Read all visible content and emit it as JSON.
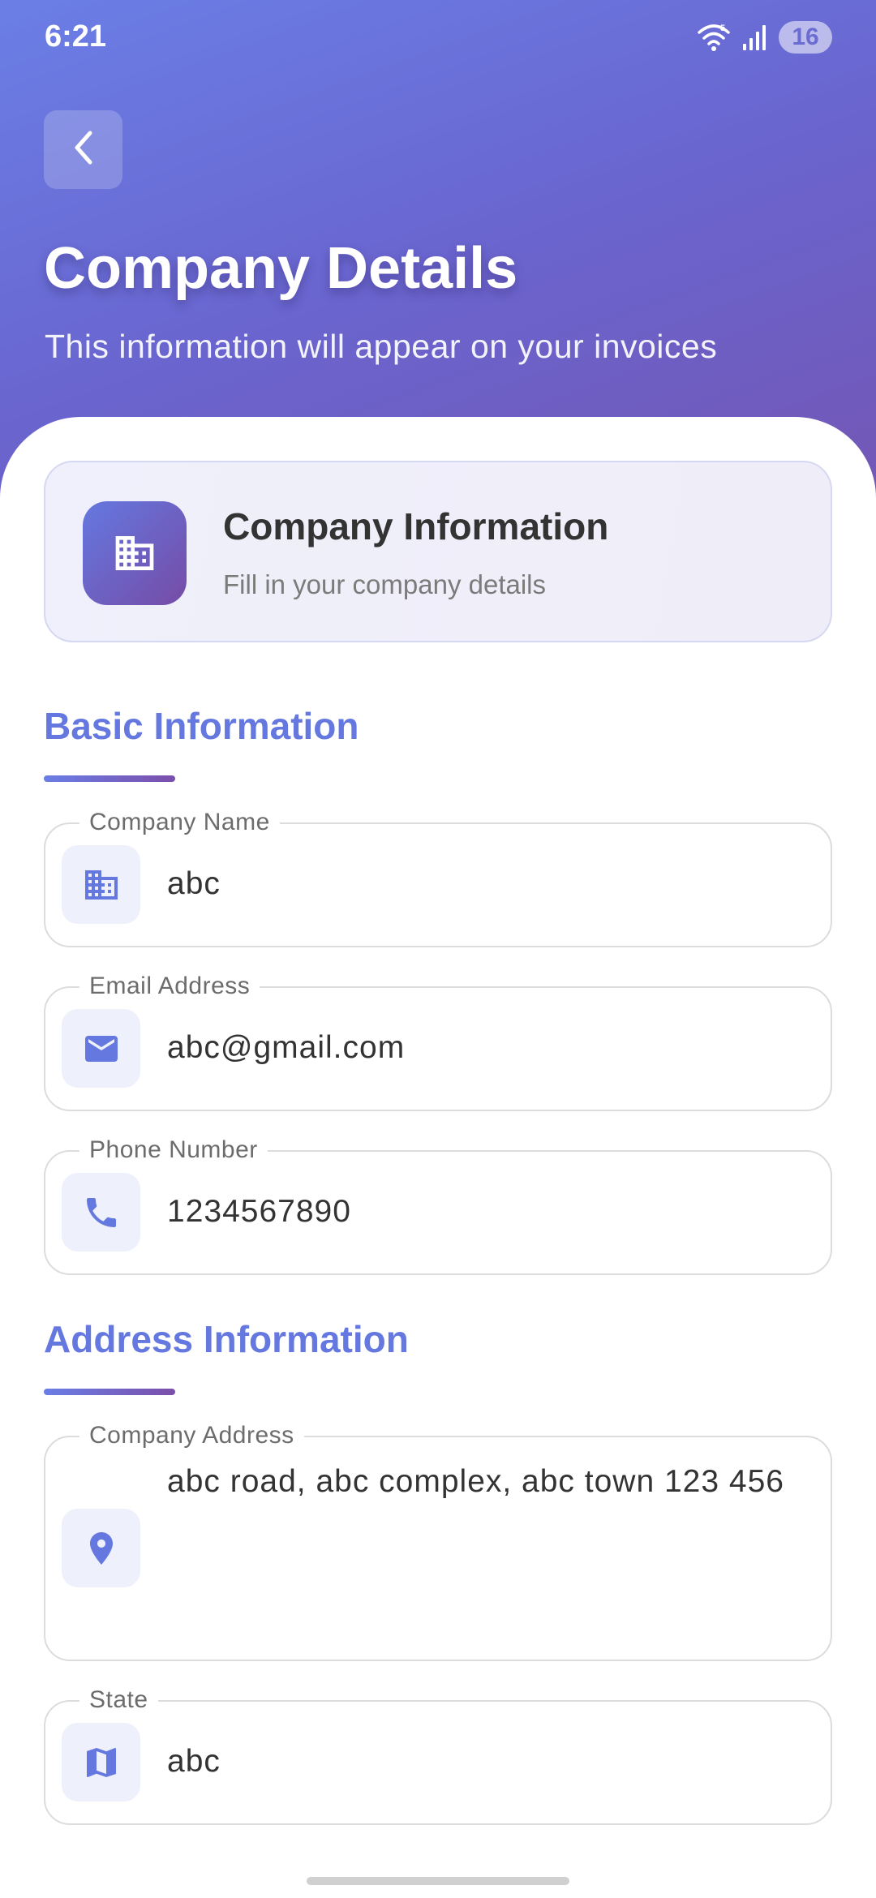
{
  "status_bar": {
    "time": "6:21",
    "battery": "16",
    "wifi_icon": "wifi-icon",
    "signal_icon": "signal-icon"
  },
  "header": {
    "back_icon": "chevron-left-icon",
    "title": "Company Details",
    "subtitle": "This information will appear on your invoices"
  },
  "info_card": {
    "icon": "building-icon",
    "title": "Company Information",
    "subtitle": "Fill in your company details"
  },
  "sections": {
    "basic": {
      "title": "Basic Information"
    },
    "address": {
      "title": "Address Information"
    }
  },
  "fields": {
    "company_name": {
      "label": "Company Name",
      "value": "abc",
      "icon": "building-icon"
    },
    "email": {
      "label": "Email Address",
      "value": "abc@gmail.com",
      "icon": "mail-icon"
    },
    "phone": {
      "label": "Phone Number",
      "value": "1234567890",
      "icon": "phone-icon"
    },
    "company_address": {
      "label": "Company Address",
      "value": "abc road, abc complex, abc town 123 456",
      "icon": "location-pin-icon"
    },
    "state": {
      "label": "State",
      "value": "abc",
      "icon": "map-icon"
    }
  },
  "colors": {
    "accent": "#6578e0",
    "gradient_start": "#6a7fe6",
    "gradient_end": "#7356b4",
    "icon_bg": "#eef0fb"
  }
}
